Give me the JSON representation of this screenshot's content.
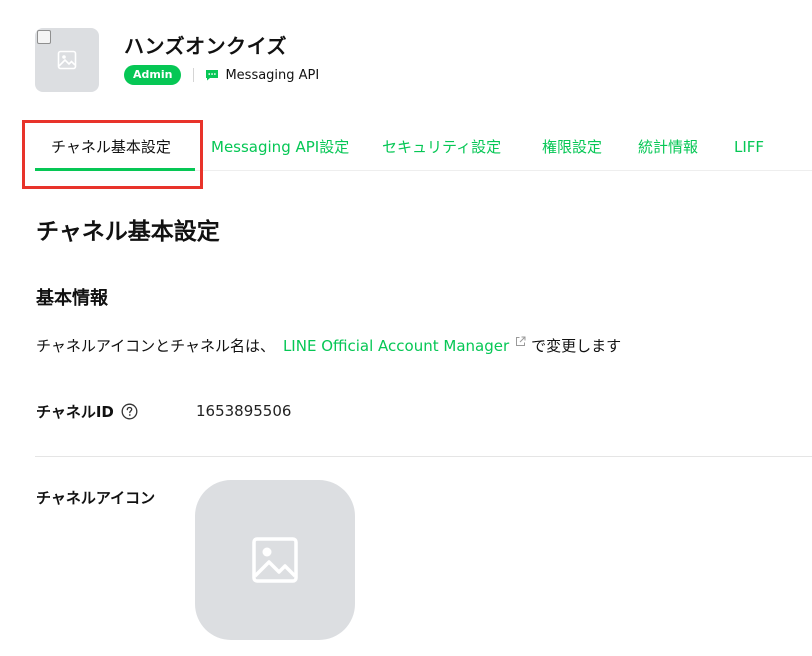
{
  "header": {
    "channel_name": "ハンズオンクイズ",
    "role_badge": "Admin",
    "channel_type": "Messaging API"
  },
  "tabs": [
    {
      "label": "チャネル基本設定",
      "active": true
    },
    {
      "label": "Messaging API設定",
      "active": false
    },
    {
      "label": "セキュリティ設定",
      "active": false
    },
    {
      "label": "権限設定",
      "active": false
    },
    {
      "label": "統計情報",
      "active": false
    },
    {
      "label": "LIFF",
      "active": false
    }
  ],
  "content": {
    "section_title": "チャネル基本設定",
    "basic_info_title": "基本情報",
    "info_prefix": "チャネルアイコンとチャネル名は、",
    "info_link": "LINE Official Account Manager",
    "info_suffix": "で変更します",
    "channel_id_label": "チャネルID",
    "channel_id_value": "1653895506",
    "channel_icon_label": "チャネルアイコン"
  },
  "colors": {
    "brand_green": "#06c755",
    "highlight_red": "#e8332a",
    "placeholder_gray": "#dcdee1"
  },
  "icons": {
    "thumbnail": "image-placeholder-icon",
    "channel_type": "chat-bubble-icon",
    "link": "external-link-icon",
    "help": "question-circle-icon"
  }
}
